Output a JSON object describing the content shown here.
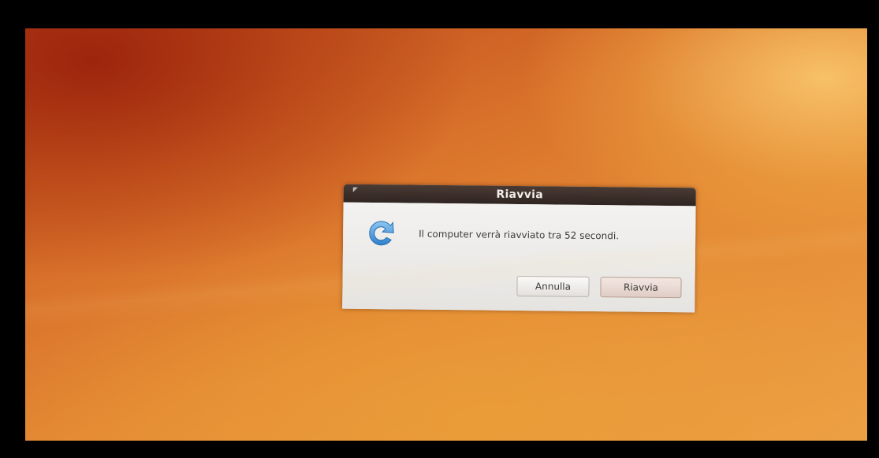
{
  "dialog": {
    "title": "Riavvia",
    "message": "Il computer verrà riavviato tra 52 secondi.",
    "icon": "restart-icon",
    "buttons": {
      "cancel_label": "Annulla",
      "restart_label": "Riavvia"
    }
  },
  "colors": {
    "titlebar": "#2f2521",
    "dialog_background": "#e9e7e4",
    "wallpaper_orange": "#e48a34",
    "icon_blue": "#3a8fd6"
  }
}
